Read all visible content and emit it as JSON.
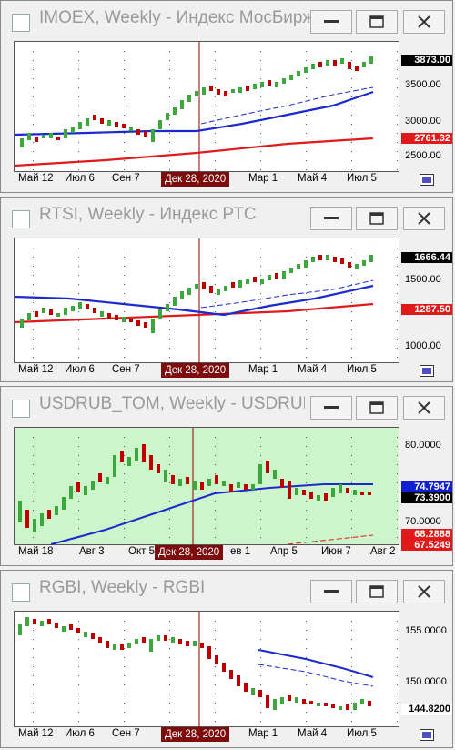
{
  "windows": [
    {
      "title": "IMOEX, Weekly - Индекс МосБиржи",
      "crosshair_date": "Дек 28, 2020",
      "x_labels": [
        "Май 12",
        "Июл 6",
        "Сен 7",
        "Мар 1",
        "Май 4",
        "Июл 5"
      ],
      "y_labels": [
        "3500.00",
        "3000.00",
        "2500.00"
      ],
      "last_price": "3873.00",
      "ma_value": "2761.32",
      "green": false
    },
    {
      "title": "RTSI, Weekly - Индекс РТС",
      "crosshair_date": "Дек 28, 2020",
      "x_labels": [
        "Май 12",
        "Июл 6",
        "Сен 7",
        "Мар 1",
        "Май 4",
        "Июл 5"
      ],
      "y_labels": [
        "1500.00",
        "1000.00"
      ],
      "last_price": "1666.44",
      "ma_value": "1287.50",
      "green": false
    },
    {
      "title": "USDRUB_TOM, Weekly - USDRUB_T...",
      "crosshair_date": "Дек 28, 2020",
      "x_labels": [
        "Май 18",
        "Авг 3",
        "Окт 5",
        "ев 1",
        "Апр 5",
        "Июн 7",
        "Авг 2"
      ],
      "y_labels": [
        "80.0000",
        "70.0000"
      ],
      "last_price": "73.3900",
      "ma_value": "74.7947",
      "ma_value_2": "68.2888",
      "ma_value_3": "67.5249",
      "green": true
    },
    {
      "title": "RGBI, Weekly - RGBI",
      "crosshair_date": "Дек 28, 2020",
      "x_labels": [
        "Май 12",
        "Июл 6",
        "Сен 7",
        "Мар 1",
        "Май 4",
        "Июл 5"
      ],
      "y_labels": [
        "155.0000",
        "150.0000"
      ],
      "last_price": "144.8200",
      "green": false
    }
  ],
  "colors": {
    "up": "#3ca83c",
    "down": "#c00000",
    "ma_fast": "#1a2ad0",
    "ma_slow": "#e01a1a",
    "crosshair": "#8b0000"
  }
}
